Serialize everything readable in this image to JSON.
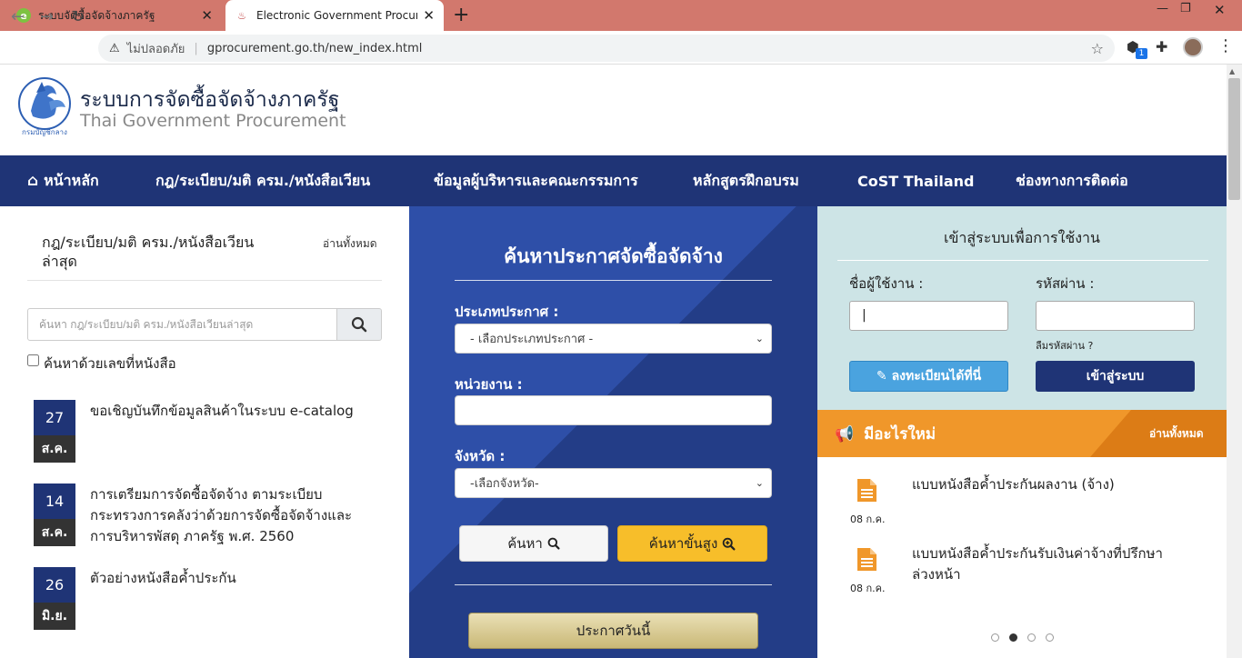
{
  "browser": {
    "tabs": [
      {
        "title": "ระบบจัดซื้อจัดจ้างภาครัฐ",
        "active": false
      },
      {
        "title": "Electronic Government Procurem",
        "active": true
      }
    ],
    "security_label": "ไม่ปลอดภัย",
    "url": "gprocurement.go.th/new_index.html",
    "extension_badge": "1"
  },
  "header": {
    "title_th": "ระบบการจัดซื้อจัดจ้างภาครัฐ",
    "title_en": "Thai Government Procurement",
    "seal_text": "กรมบัญชีกลาง"
  },
  "nav": {
    "items": [
      "หน้าหลัก",
      "กฎ/ระเบียบ/มติ ครม./หนังสือเวียน",
      "ข้อมูลผู้บริหารและคณะกรรมการ",
      "หลักสูตรฝึกอบรม",
      "CoST Thailand",
      "ช่องทางการติดต่อ"
    ]
  },
  "regulations": {
    "title": "กฎ/ระเบียบ/มติ ครม./หนังสือเวียนล่าสุด",
    "read_all": "อ่านทั้งหมด",
    "search_placeholder": "ค้นหา กฎ/ระเบียบ/มติ ครม./หนังสือเวียนล่าสุด",
    "checkbox_label": "ค้นหาด้วยเลขที่หนังสือ",
    "items": [
      {
        "day": "27",
        "month": "ส.ค.",
        "text": "ขอเชิญบันทึกข้อมูลสินค้าในระบบ e-catalog"
      },
      {
        "day": "14",
        "month": "ส.ค.",
        "text": "การเตรียมการจัดซื้อจัดจ้าง ตามระเบียบกระทรวงการคลังว่าด้วยการจัดซื้อจัดจ้างและการบริหารพัสดุ ภาครัฐ พ.ศ. 2560"
      },
      {
        "day": "26",
        "month": "มิ.ย.",
        "text": "ตัวอย่างหนังสือค้ำประกัน"
      }
    ]
  },
  "search_panel": {
    "title": "ค้นหาประกาศจัดซื้อจัดจ้าง",
    "type_label": "ประเภทประกาศ :",
    "type_value": "- เลือกประเภทประกาศ -",
    "agency_label": "หน่วยงาน :",
    "province_label": "จังหวัด :",
    "province_value": "-เลือกจังหวัด-",
    "search_button": "ค้นหา",
    "advanced_button": "ค้นหาขั้นสูง",
    "today_button": "ประกาศวันนี้"
  },
  "login": {
    "title": "เข้าสู่ระบบเพื่อการใช้งาน",
    "username_label": "ชื่อผู้ใช้งาน :",
    "password_label": "รหัสผ่าน :",
    "forgot": "ลืมรหัสผ่าน ?",
    "register_button": "ลงทะเบียนได้ที่นี่",
    "login_button": "เข้าสู่ระบบ"
  },
  "whats_new": {
    "title": "มีอะไรใหม่",
    "read_all": "อ่านทั้งหมด",
    "items": [
      {
        "date": "08 ก.ค.",
        "text": "แบบหนังสือค้ำประกันผลงาน (จ้าง)"
      },
      {
        "date": "08 ก.ค.",
        "text": "แบบหนังสือค้ำประกันรับเงินค่าจ้างที่ปรึกษาล่วงหน้า"
      }
    ],
    "active_page": 2,
    "page_count": 4
  },
  "colors": {
    "nav": "#1f3476",
    "accent_orange": "#f0972a",
    "login_panel": "#cde4e6",
    "search_panel": "#2e4fa8"
  }
}
